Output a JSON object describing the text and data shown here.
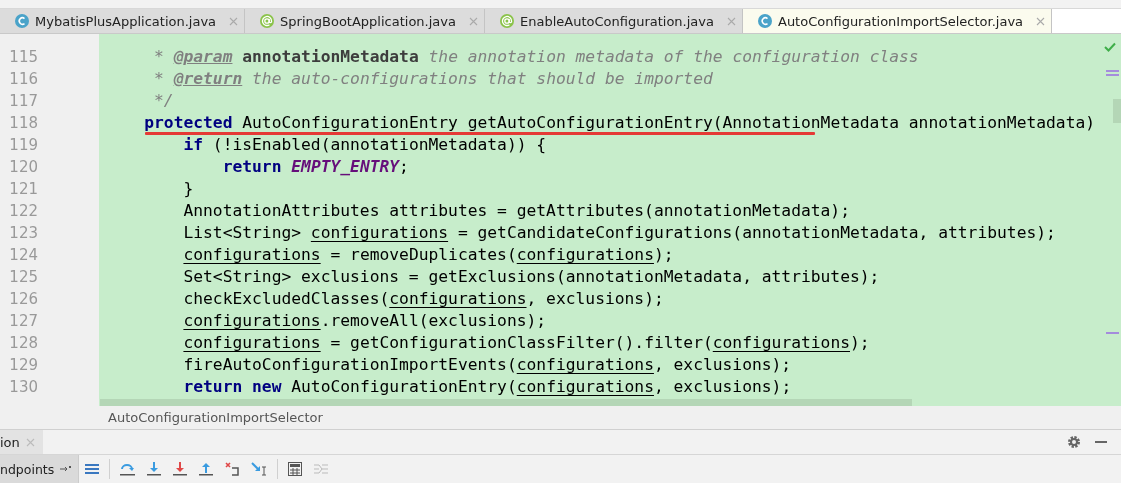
{
  "tabs": [
    {
      "label": "MybatisPlusApplication.java",
      "kind": "class",
      "selected": false
    },
    {
      "label": "SpringBootApplication.java",
      "kind": "annotation",
      "selected": false
    },
    {
      "label": "EnableAutoConfiguration.java",
      "kind": "annotation",
      "selected": false
    },
    {
      "label": "AutoConfigurationImportSelector.java",
      "kind": "class",
      "selected": true
    }
  ],
  "editor": {
    "lines": [
      {
        "number": "115",
        "marked": false,
        "tokens": [
          {
            "text": "     * ",
            "kind": "comment"
          },
          {
            "text": "@param",
            "kind": "doctag"
          },
          {
            "text": " annotationMetadata",
            "kind": "docparam"
          },
          {
            "text": " the annotation metadata of the configuration class",
            "kind": "comment"
          }
        ]
      },
      {
        "number": "116",
        "marked": false,
        "tokens": [
          {
            "text": "     * ",
            "kind": "comment"
          },
          {
            "text": "@return",
            "kind": "doctag"
          },
          {
            "text": " the auto-configurations that should be imported",
            "kind": "comment"
          }
        ]
      },
      {
        "number": "117",
        "marked": false,
        "tokens": [
          {
            "text": "     */",
            "kind": "comment"
          }
        ]
      },
      {
        "number": "118",
        "marked": true,
        "tokens": [
          {
            "text": "    protected",
            "kind": "keyword"
          },
          {
            "text": " AutoConfigurationEntry getAutoConfigurationEntry(AnnotationMetadata annotationMetadata)",
            "kind": "plain"
          }
        ]
      },
      {
        "number": "119",
        "marked": false,
        "tokens": [
          {
            "text": "        if",
            "kind": "keyword"
          },
          {
            "text": " (!isEnabled(annotationMetadata)) {",
            "kind": "plain"
          }
        ]
      },
      {
        "number": "120",
        "marked": false,
        "tokens": [
          {
            "text": "            return",
            "kind": "keyword"
          },
          {
            "text": " EMPTY_ENTRY",
            "kind": "constant"
          },
          {
            "text": ";",
            "kind": "plain"
          }
        ]
      },
      {
        "number": "121",
        "marked": false,
        "tokens": [
          {
            "text": "        }",
            "kind": "plain"
          }
        ]
      },
      {
        "number": "122",
        "marked": false,
        "tokens": [
          {
            "text": "        AnnotationAttributes attributes = getAttributes(annotationMetadata);",
            "kind": "plain"
          }
        ]
      },
      {
        "number": "123",
        "marked": false,
        "tokens": [
          {
            "text": "        List<String> ",
            "kind": "plain"
          },
          {
            "text": "configurations",
            "kind": "reassigned"
          },
          {
            "text": " = getCandidateConfigurations(annotationMetadata, attributes);",
            "kind": "plain"
          }
        ]
      },
      {
        "number": "124",
        "marked": false,
        "tokens": [
          {
            "text": "        configurations",
            "kind": "reassigned"
          },
          {
            "text": " = removeDuplicates(",
            "kind": "plain"
          },
          {
            "text": "configurations",
            "kind": "reassigned"
          },
          {
            "text": ");",
            "kind": "plain"
          }
        ]
      },
      {
        "number": "125",
        "marked": false,
        "tokens": [
          {
            "text": "        Set<String> exclusions = getExclusions(annotationMetadata, attributes);",
            "kind": "plain"
          }
        ]
      },
      {
        "number": "126",
        "marked": false,
        "tokens": [
          {
            "text": "        checkExcludedClasses(",
            "kind": "plain"
          },
          {
            "text": "configurations",
            "kind": "reassigned"
          },
          {
            "text": ", exclusions);",
            "kind": "plain"
          }
        ]
      },
      {
        "number": "127",
        "marked": false,
        "tokens": [
          {
            "text": "        configurations",
            "kind": "reassigned"
          },
          {
            "text": ".removeAll(exclusions);",
            "kind": "plain"
          }
        ]
      },
      {
        "number": "128",
        "marked": false,
        "tokens": [
          {
            "text": "        configurations",
            "kind": "reassigned"
          },
          {
            "text": " = getConfigurationClassFilter().filter(",
            "kind": "plain"
          },
          {
            "text": "configurations",
            "kind": "reassigned"
          },
          {
            "text": ");",
            "kind": "plain"
          }
        ]
      },
      {
        "number": "129",
        "marked": false,
        "tokens": [
          {
            "text": "        fireAutoConfigurationImportEvents(",
            "kind": "plain"
          },
          {
            "text": "configurations",
            "kind": "reassigned"
          },
          {
            "text": ", exclusions);",
            "kind": "plain"
          }
        ]
      },
      {
        "number": "130",
        "marked": false,
        "tokens": [
          {
            "text": "        return new",
            "kind": "keyword"
          },
          {
            "text": " AutoConfigurationEntry(",
            "kind": "plain"
          },
          {
            "text": "configurations",
            "kind": "reassigned"
          },
          {
            "text": ", exclusions);",
            "kind": "plain"
          }
        ]
      }
    ]
  },
  "breadcrumb": "AutoConfigurationImportSelector",
  "debug_panel": {
    "tab": "ion",
    "subtab": "ndpoints"
  }
}
